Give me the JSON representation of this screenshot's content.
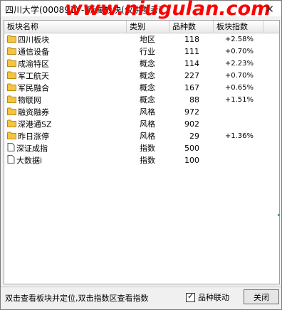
{
  "window": {
    "title": "四川大学(000891) - 所属板块(仅供参考)",
    "watermark": "www.niugulan.com",
    "close_glyph": "✕"
  },
  "table": {
    "headers": [
      "板块名称",
      "类别",
      "品种数",
      "板块指数"
    ],
    "rows": [
      {
        "name": "四川板块",
        "type": "地区",
        "count": "118",
        "index": "+2.58%",
        "icon": "folder-icon"
      },
      {
        "name": "通信设备",
        "type": "行业",
        "count": "111",
        "index": "+0.70%",
        "icon": "folder-icon"
      },
      {
        "name": "成渝特区",
        "type": "概念",
        "count": "114",
        "index": "+2.23%",
        "icon": "folder-icon"
      },
      {
        "name": "军工航天",
        "type": "概念",
        "count": "227",
        "index": "+0.70%",
        "icon": "folder-icon"
      },
      {
        "name": "军民融合",
        "type": "概念",
        "count": "167",
        "index": "+0.65%",
        "icon": "folder-icon"
      },
      {
        "name": "物联网",
        "type": "概念",
        "count": "88",
        "index": "+1.51%",
        "icon": "folder-icon"
      },
      {
        "name": "融资融券",
        "type": "风格",
        "count": "972",
        "index": "",
        "icon": "folder-icon"
      },
      {
        "name": "深港通SZ",
        "type": "风格",
        "count": "902",
        "index": "",
        "icon": "folder-icon"
      },
      {
        "name": "昨日涨停",
        "type": "风格",
        "count": "29",
        "index": "+1.36%",
        "icon": "folder-icon"
      },
      {
        "name": "深证成指",
        "type": "指数",
        "count": "500",
        "index": "",
        "icon": "document-icon"
      },
      {
        "name": "大数据i",
        "type": "指数",
        "count": "100",
        "index": "",
        "icon": "document-icon"
      }
    ]
  },
  "footer": {
    "hint": "双击查看板块并定位,双击指数区查看指数",
    "checkbox_label": "品种联动",
    "checkbox_checked": true,
    "checkmark": "✓",
    "close_button": "关闭"
  },
  "colors": {
    "folder_fill": "#f5c542",
    "folder_stroke": "#b88a10",
    "watermark": "#ff0000"
  }
}
